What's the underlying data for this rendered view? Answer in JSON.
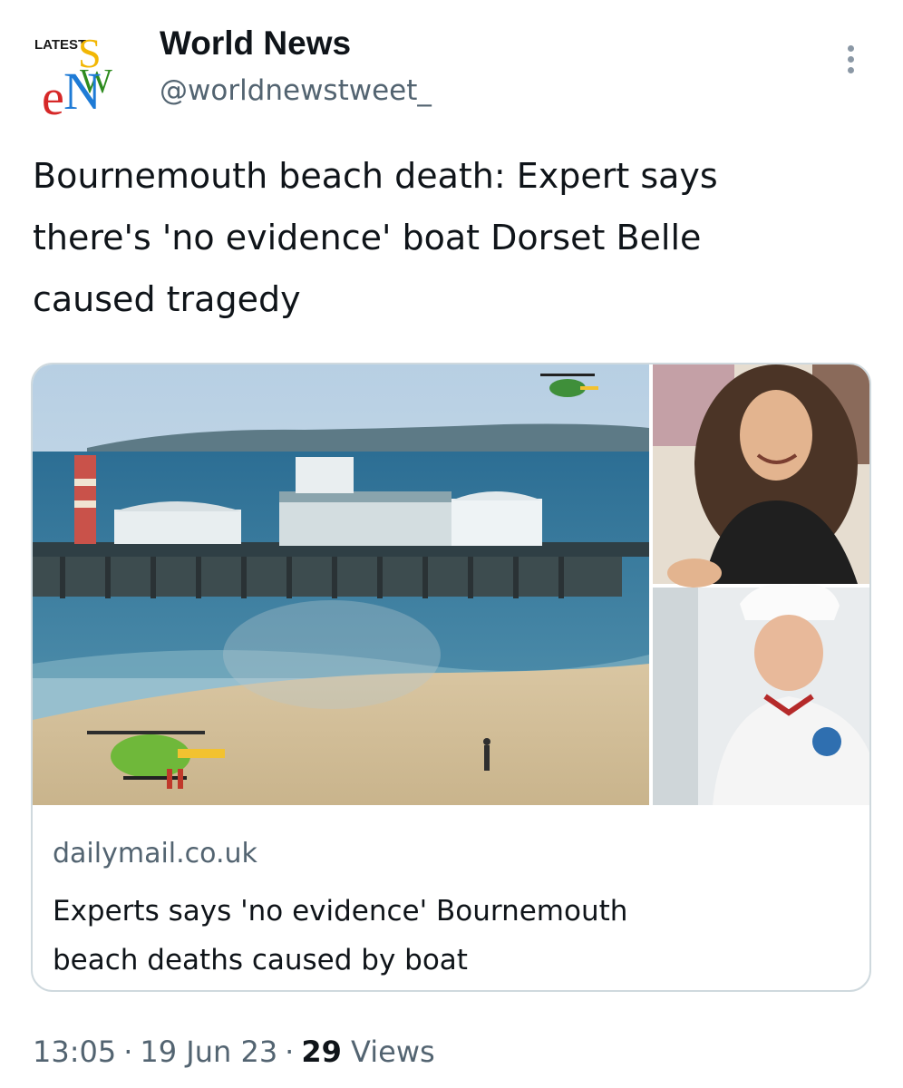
{
  "author": {
    "name": "World News",
    "handle": "@worldnewstweet_",
    "avatar_logo": {
      "badge_text": "LATEST",
      "letters": [
        "e",
        "N",
        "W",
        "S"
      ],
      "colors": [
        "#d62828",
        "#1e7bd6",
        "#2e8b1f",
        "#f2b705"
      ]
    }
  },
  "more_icon": "more-vertical-icon",
  "tweet": {
    "text_lines": [
      "Bournemouth beach death: Expert says",
      "there's 'no evidence' boat Dorset Belle",
      "caused tragedy"
    ]
  },
  "link_card": {
    "domain": "dailymail.co.uk",
    "title_lines": [
      "Experts says 'no evidence' Bournemouth",
      "beach deaths caused by boat"
    ],
    "media": {
      "main_photo": "pier-beach-helicopter-photo",
      "side_photo_top": "smiling-girl-photo",
      "side_photo_bottom": "chef-uniform-photo"
    }
  },
  "meta": {
    "time": "13:05",
    "date": "19 Jun 23",
    "views_count": "29",
    "views_label": "Views",
    "separator": "·"
  },
  "colors": {
    "text_primary": "#0f1419",
    "text_secondary": "#536471",
    "card_border": "#cfd9de"
  }
}
